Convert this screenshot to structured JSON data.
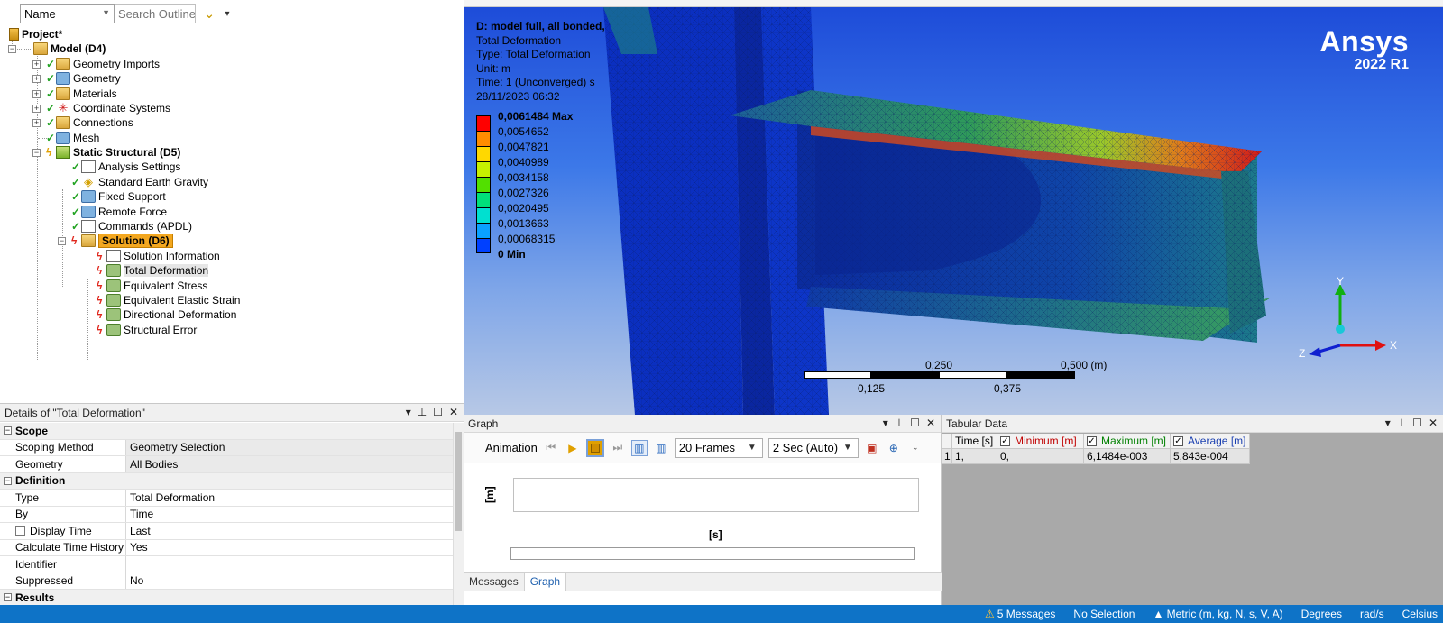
{
  "outline": {
    "filter_select": "Name",
    "search_placeholder": "Search Outline",
    "tree": {
      "project": "Project*",
      "model": "Model (D4)",
      "geometry_imports": "Geometry Imports",
      "geometry": "Geometry",
      "materials": "Materials",
      "coordinate_systems": "Coordinate Systems",
      "connections": "Connections",
      "mesh": "Mesh",
      "static_structural": "Static Structural (D5)",
      "analysis_settings": "Analysis Settings",
      "standard_earth_gravity": "Standard Earth Gravity",
      "fixed_support": "Fixed Support",
      "remote_force": "Remote Force",
      "commands_apdl": "Commands (APDL)",
      "solution": "Solution (D6)",
      "solution_information": "Solution Information",
      "total_deformation": "Total Deformation",
      "equivalent_stress": "Equivalent Stress",
      "equivalent_elastic_strain": "Equivalent Elastic Strain",
      "directional_deformation": "Directional Deformation",
      "structural_error": "Structural Error"
    }
  },
  "details": {
    "title": "Details of \"Total Deformation\"",
    "sections": {
      "scope": "Scope",
      "definition": "Definition",
      "results": "Results"
    },
    "rows": {
      "scoping_method": {
        "k": "Scoping Method",
        "v": "Geometry Selection"
      },
      "geometry": {
        "k": "Geometry",
        "v": "All Bodies"
      },
      "type": {
        "k": "Type",
        "v": "Total Deformation"
      },
      "by": {
        "k": "By",
        "v": "Time"
      },
      "display_time": {
        "k": "Display Time",
        "v": "Last"
      },
      "calc_time_history": {
        "k": "Calculate Time History",
        "v": "Yes"
      },
      "identifier": {
        "k": "Identifier",
        "v": ""
      },
      "suppressed": {
        "k": "Suppressed",
        "v": "No"
      }
    }
  },
  "viewport": {
    "info_title": "D: model full, all bonded,",
    "info_lines": [
      "Total Deformation",
      "Type: Total Deformation",
      "Unit: m",
      "Time: 1 (Unconverged) s",
      "28/11/2023 06:32"
    ],
    "legend": {
      "max_label": "0,0061484 Max",
      "levels": [
        "0,0054652",
        "0,0047821",
        "0,0040989",
        "0,0034158",
        "0,0027326",
        "0,0020495",
        "0,0013663",
        "0,00068315"
      ],
      "min_label": "0 Min",
      "colors": [
        "#ff0000",
        "#ff8c00",
        "#ffd800",
        "#c6f000",
        "#52e000",
        "#00e07a",
        "#00e0d0",
        "#0aa0ff",
        "#0040ff"
      ]
    },
    "brand": {
      "name": "Ansys",
      "version": "2022 R1"
    },
    "scale": {
      "t1": "0,250",
      "t2": "0,500 (m)",
      "b1": "0,125",
      "b2": "0,375"
    },
    "triad": {
      "x": "X",
      "y": "Y",
      "z": "Z"
    }
  },
  "graph": {
    "title": "Graph",
    "animation_label": "Animation",
    "frames": "20 Frames",
    "duration": "2 Sec (Auto)",
    "y_label": "[m]",
    "x_label": "[s]",
    "tabs": [
      "Messages",
      "Graph"
    ]
  },
  "tabular": {
    "title": "Tabular Data",
    "headers": {
      "row": "",
      "time": "Time [s]",
      "min": "Minimum [m]",
      "max": "Maximum [m]",
      "avg": "Average [m]"
    },
    "header_colors": {
      "min": "#c00000",
      "max": "#008000",
      "avg": "#1a3fb0"
    },
    "row1": {
      "idx": "1",
      "time": "1,",
      "min": "0,",
      "max": "6,1484e-003",
      "avg": "5,843e-004"
    }
  },
  "status": {
    "messages": "5 Messages",
    "selection": "No Selection",
    "units": "Metric (m, kg, N, s, V, A)",
    "angle": "Degrees",
    "rot": "rad/s",
    "temp": "Celsius"
  }
}
